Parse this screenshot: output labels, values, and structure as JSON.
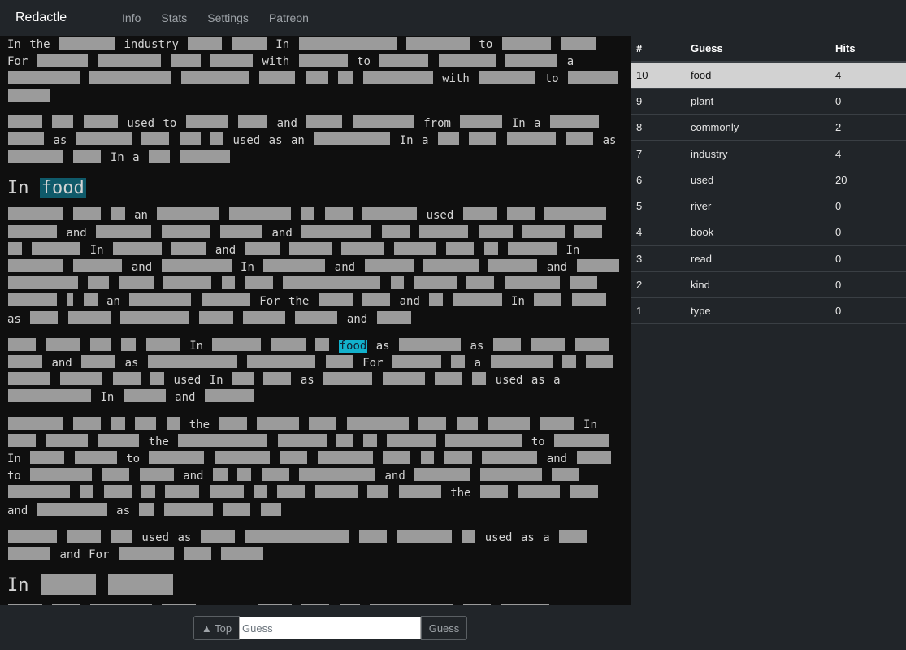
{
  "app": {
    "brand": "Redactle",
    "nav": [
      "Info",
      "Stats",
      "Settings",
      "Patreon"
    ]
  },
  "article": {
    "words": {
      "in": "In",
      "food": "food",
      "the": "the",
      "industry": "industry",
      "for": "For",
      "with": "with",
      "to": "to",
      "a": "a",
      "used": "used",
      "and": "and",
      "from": "from",
      "as": "as",
      "an": "an"
    }
  },
  "guesses": {
    "headers": [
      "#",
      "Guess",
      "Hits"
    ],
    "rows": [
      {
        "num": "10",
        "guess": "food",
        "hits": "4"
      },
      {
        "num": "9",
        "guess": "plant",
        "hits": "0"
      },
      {
        "num": "8",
        "guess": "commonly",
        "hits": "2"
      },
      {
        "num": "7",
        "guess": "industry",
        "hits": "4"
      },
      {
        "num": "6",
        "guess": "used",
        "hits": "20"
      },
      {
        "num": "5",
        "guess": "river",
        "hits": "0"
      },
      {
        "num": "4",
        "guess": "book",
        "hits": "0"
      },
      {
        "num": "3",
        "guess": "read",
        "hits": "0"
      },
      {
        "num": "2",
        "guess": "kind",
        "hits": "0"
      },
      {
        "num": "1",
        "guess": "type",
        "hits": "0"
      }
    ]
  },
  "controls": {
    "top_label": "▲ Top",
    "guess_placeholder": "Guess",
    "guess_button": "Guess"
  }
}
